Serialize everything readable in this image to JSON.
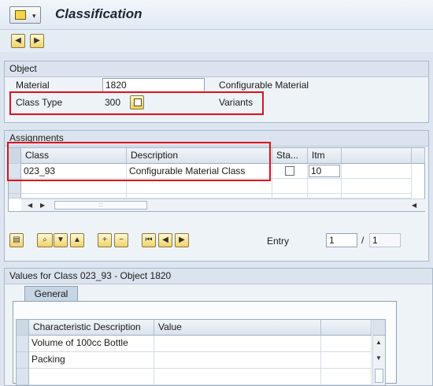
{
  "header": {
    "title": "Classification"
  },
  "object_group": {
    "title": "Object",
    "material_label": "Material",
    "material_value": "1820",
    "material_desc": "Configurable Material",
    "class_type_label": "Class Type",
    "class_type_value": "300",
    "class_type_desc": "Variants"
  },
  "assignments": {
    "title": "Assignments",
    "columns": [
      "Class",
      "Description",
      "Sta...",
      "Itm"
    ],
    "rows": [
      {
        "class": "023_93",
        "description": "Configurable Material Class",
        "status_checked": false,
        "item": "10"
      }
    ],
    "entry_label": "Entry",
    "entry_value": "1",
    "entry_total": "1",
    "entry_separator": "/"
  },
  "values": {
    "title": "Values for Class 023_93 - Object 1820",
    "tab_label": "General",
    "columns": [
      "Characteristic Description",
      "Value"
    ],
    "rows": [
      {
        "description": "Volume of 100cc Bottle",
        "value": ""
      },
      {
        "description": "Packing",
        "value": ""
      }
    ]
  },
  "colors": {
    "highlight": "#e0101c",
    "background": "#dde6f0"
  },
  "icons": [
    "screen-icon",
    "back-icon",
    "forward-icon",
    "f4-help-icon",
    "details-icon",
    "search-icon",
    "sort-desc-icon",
    "sort-asc-icon",
    "insert-row-icon",
    "delete-row-icon",
    "first-page-icon",
    "prev-page-icon",
    "next-page-icon"
  ]
}
